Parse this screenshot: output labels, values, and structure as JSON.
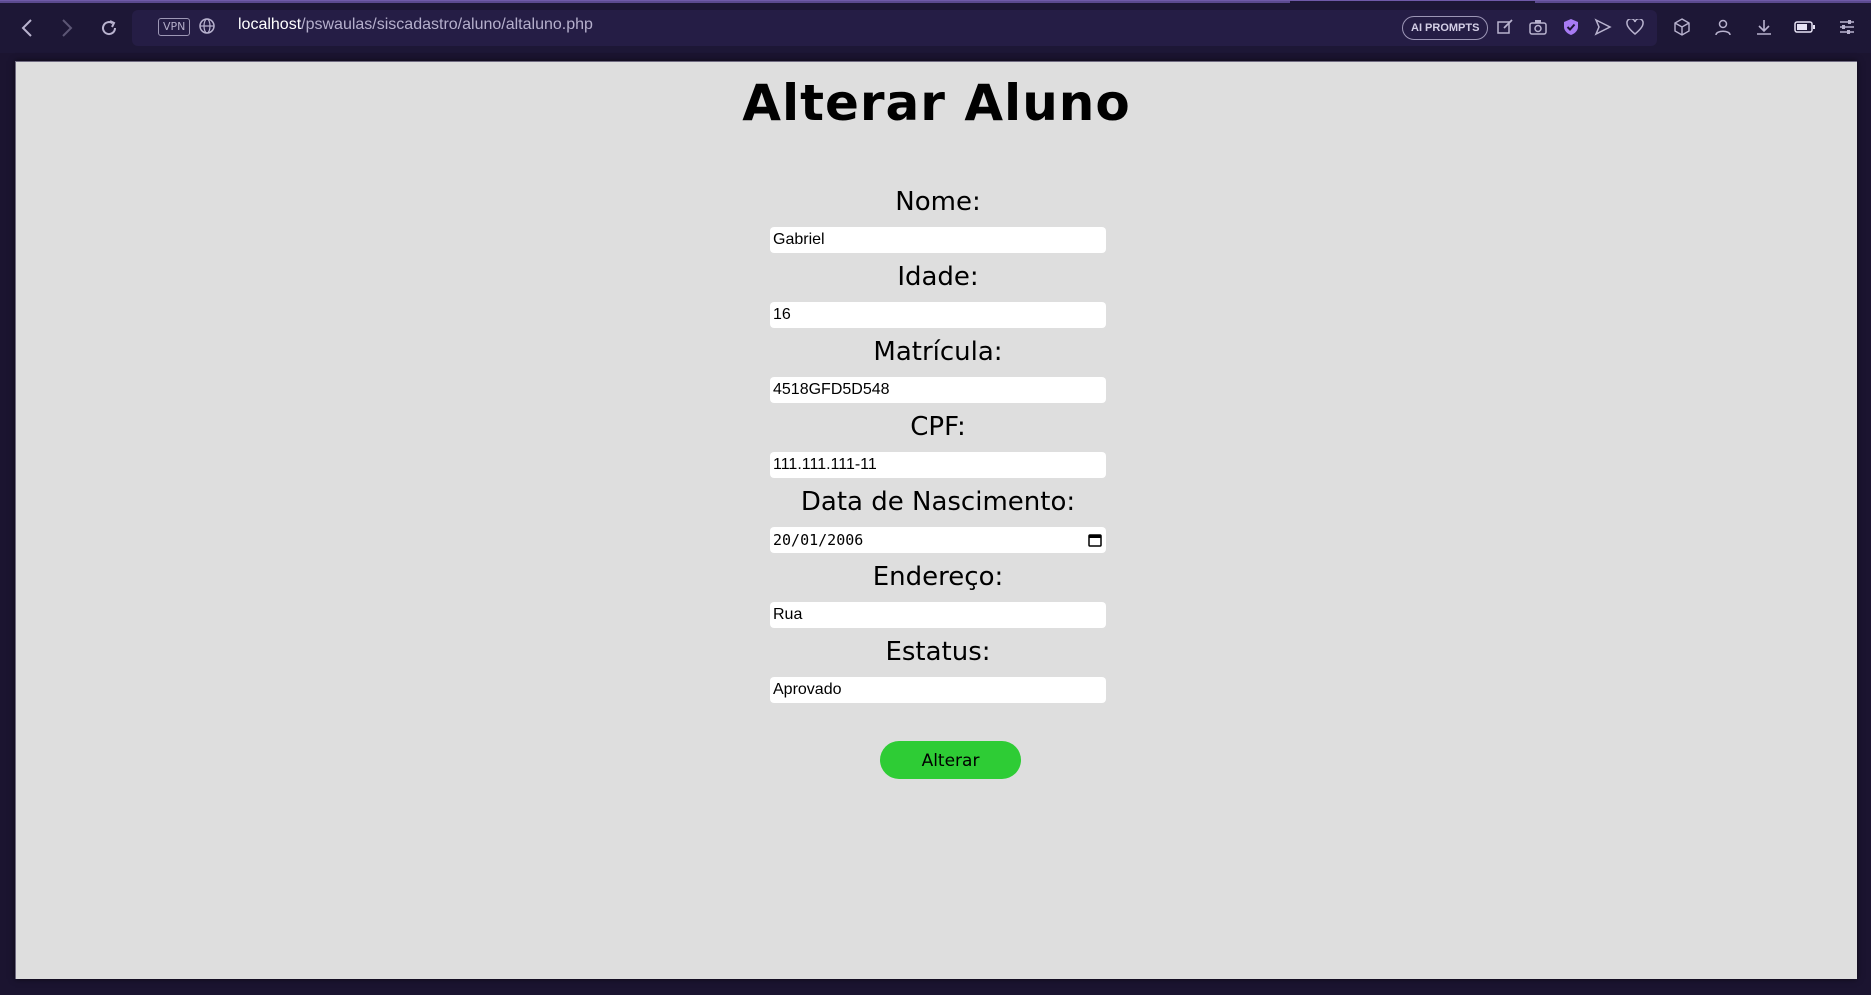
{
  "browser": {
    "url_host": "localhost",
    "url_path": "/pswaulas/siscadastro/aluno/altaluno.php",
    "vpn_label": "VPN",
    "ai_prompts_label": "AI PROMPTS"
  },
  "page": {
    "title": "Alterar Aluno",
    "fields": [
      {
        "label": "Nome:",
        "value": "Gabriel"
      },
      {
        "label": "Idade:",
        "value": "16"
      },
      {
        "label": "Matrícula:",
        "value": "4518GFD5D548"
      },
      {
        "label": "CPF:",
        "value": "111.111.111-11"
      },
      {
        "label": "Data de Nascimento:",
        "value": "20/01/2006"
      },
      {
        "label": "Endereço:",
        "value": "Rua"
      },
      {
        "label": "Estatus:",
        "value": "Aprovado"
      }
    ],
    "submit_label": "Alterar"
  },
  "colors": {
    "chrome_background": "#1d1736",
    "page_background": "#dedede",
    "button_green": "#2ecc35"
  },
  "icons": [
    "back-icon",
    "forward-icon",
    "reload-icon",
    "globe-icon",
    "edit-icon",
    "camera-icon",
    "shield-icon",
    "send-icon",
    "heart-icon",
    "cube-icon",
    "profile-icon",
    "download-icon",
    "battery-icon",
    "settings-icon",
    "calendar-icon"
  ]
}
